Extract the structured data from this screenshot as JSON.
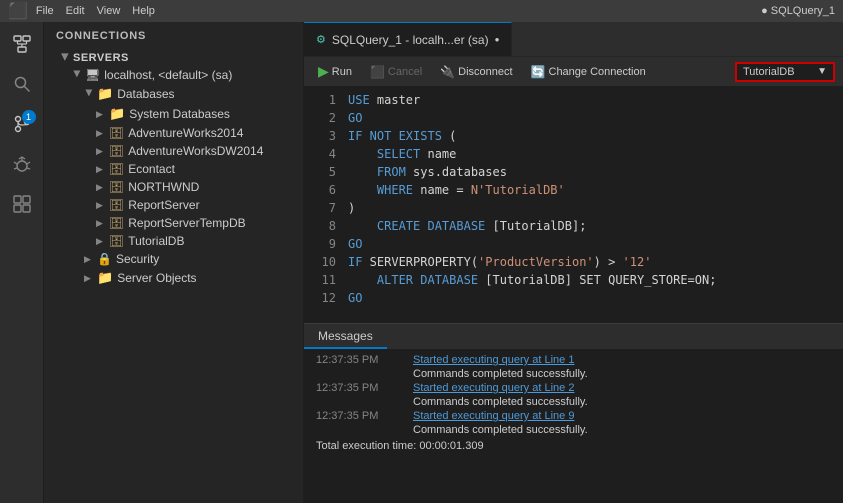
{
  "titlebar": {
    "menu_items": [
      "File",
      "Edit",
      "View",
      "Help"
    ],
    "app_icon": "●",
    "tab_title": "SQLQuery_1"
  },
  "sidebar": {
    "header": "CONNECTIONS",
    "servers_label": "SERVERS",
    "tree": [
      {
        "id": "server",
        "label": "localhost, <default> (sa)",
        "indent": 1,
        "type": "server",
        "expanded": true
      },
      {
        "id": "databases",
        "label": "Databases",
        "indent": 2,
        "type": "folder",
        "expanded": true
      },
      {
        "id": "systemdb",
        "label": "System Databases",
        "indent": 3,
        "type": "folder",
        "expanded": false
      },
      {
        "id": "adventureworks",
        "label": "AdventureWorks2014",
        "indent": 3,
        "type": "db",
        "expanded": false
      },
      {
        "id": "adventureworksdw",
        "label": "AdventureWorksDW2014",
        "indent": 3,
        "type": "db",
        "expanded": false
      },
      {
        "id": "econtact",
        "label": "Econtact",
        "indent": 3,
        "type": "db",
        "expanded": false
      },
      {
        "id": "northwnd",
        "label": "NORTHWND",
        "indent": 3,
        "type": "db",
        "expanded": false
      },
      {
        "id": "reportserver",
        "label": "ReportServer",
        "indent": 3,
        "type": "db",
        "expanded": false
      },
      {
        "id": "reportservertemp",
        "label": "ReportServerTempDB",
        "indent": 3,
        "type": "db",
        "expanded": false
      },
      {
        "id": "tutorialdb",
        "label": "TutorialDB",
        "indent": 3,
        "type": "db",
        "expanded": false
      },
      {
        "id": "security",
        "label": "Security",
        "indent": 2,
        "type": "security",
        "expanded": false
      },
      {
        "id": "serverobjects",
        "label": "Server Objects",
        "indent": 2,
        "type": "folder",
        "expanded": false
      }
    ]
  },
  "editor": {
    "tab_label": "SQLQuery_1 - localh...er (sa)",
    "tab_dot": "●",
    "toolbar": {
      "run_label": "Run",
      "cancel_label": "Cancel",
      "disconnect_label": "Disconnect",
      "change_connection_label": "Change Connection",
      "database": "TutorialDB"
    },
    "code_lines": [
      {
        "num": 1,
        "tokens": [
          {
            "t": "USE",
            "c": "kw"
          },
          {
            "t": " master",
            "c": ""
          }
        ]
      },
      {
        "num": 2,
        "tokens": [
          {
            "t": "GO",
            "c": "kw"
          }
        ]
      },
      {
        "num": 3,
        "tokens": [
          {
            "t": "IF NOT EXISTS",
            "c": "kw"
          },
          {
            "t": " (",
            "c": ""
          }
        ]
      },
      {
        "num": 4,
        "tokens": [
          {
            "t": "    SELECT",
            "c": "kw"
          },
          {
            "t": " name",
            "c": ""
          }
        ]
      },
      {
        "num": 5,
        "tokens": [
          {
            "t": "    FROM",
            "c": "kw"
          },
          {
            "t": " sys.databases",
            "c": ""
          }
        ]
      },
      {
        "num": 6,
        "tokens": [
          {
            "t": "    WHERE",
            "c": "kw"
          },
          {
            "t": " name = ",
            "c": ""
          },
          {
            "t": "N'TutorialDB'",
            "c": "str"
          }
        ]
      },
      {
        "num": 7,
        "tokens": [
          {
            "t": ")",
            "c": ""
          }
        ]
      },
      {
        "num": 8,
        "tokens": [
          {
            "t": "    CREATE DATABASE",
            "c": "kw"
          },
          {
            "t": " [TutorialDB];",
            "c": ""
          }
        ]
      },
      {
        "num": 9,
        "tokens": [
          {
            "t": "GO",
            "c": "kw"
          }
        ]
      },
      {
        "num": 10,
        "tokens": [
          {
            "t": "IF",
            "c": "kw"
          },
          {
            "t": " SERVERPROPERTY(",
            "c": ""
          },
          {
            "t": "'ProductVersion'",
            "c": "str"
          },
          {
            "t": ") > ",
            "c": ""
          },
          {
            "t": "'12'",
            "c": "str"
          }
        ]
      },
      {
        "num": 11,
        "tokens": [
          {
            "t": "    ALTER DATABASE",
            "c": "kw"
          },
          {
            "t": " [TutorialDB] SET QUERY_STORE=ON;",
            "c": ""
          }
        ]
      },
      {
        "num": 12,
        "tokens": [
          {
            "t": "GO",
            "c": "kw"
          }
        ]
      }
    ]
  },
  "results": {
    "tab_label": "Messages",
    "messages": [
      {
        "time": "12:37:35 PM",
        "link": "Started executing query at Line 1",
        "followup": "Commands completed successfully."
      },
      {
        "time": "12:37:35 PM",
        "link": "Started executing query at Line 2",
        "followup": "Commands completed successfully."
      },
      {
        "time": "12:37:35 PM",
        "link": "Started executing query at Line 9",
        "followup": "Commands completed successfully."
      }
    ],
    "total": "Total execution time: 00:00:01.309"
  }
}
